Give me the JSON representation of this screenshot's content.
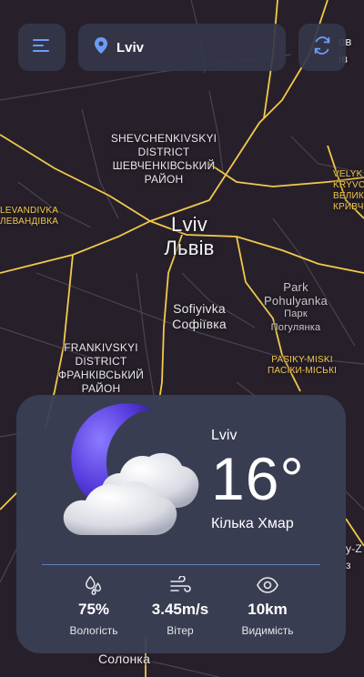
{
  "app": {
    "search": {
      "location": "Lviv"
    },
    "icons": {
      "menu": "menu-lines-icon",
      "location": "location-pin-icon",
      "refresh": "refresh-icon"
    }
  },
  "map": {
    "labels": {
      "shevchenkivskyi": [
        "SHEVCHENKIVSKYI",
        "DISTRICT",
        "ШЕВЧЕНКІВСЬКИЙ",
        "РАЙОН"
      ],
      "lviv_en": "Lviv",
      "lviv_uk": "Львів",
      "sofiyivka": [
        "Sofiyivka",
        "Софіївка"
      ],
      "park": [
        "Park",
        "Pohulyanka",
        "Парк",
        "Погулянка"
      ],
      "frankivskyi": [
        "FRANKIVSKYI",
        "DISTRICT",
        "ФРАНКІВСЬКИЙ",
        "РАЙОН"
      ],
      "levandivka": [
        "LEVANDIVKA",
        "ЛЕВАНДІВКА"
      ],
      "velyki_kryvchytsi": [
        "VELYK",
        "KRYVCHY",
        "ВЕЛИК",
        "КРИВЧ"
      ],
      "pasiky": [
        "PASIKY-MISKI",
        "ПАСІКИ-МІСЬКІ"
      ],
      "solonka": "Солонка",
      "top_right": [
        "ов",
        "ів"
      ],
      "right_edge": [
        "y-Z",
        "з"
      ]
    }
  },
  "weather": {
    "city": "Lviv",
    "temperature": "16°",
    "description": "Кілька Хмар",
    "icon": "moon-cloud-icon",
    "stats": [
      {
        "value": "75%",
        "label": "Вологість",
        "icon": "humidity-drops-icon"
      },
      {
        "value": "3.45m/s",
        "label": "Вітер",
        "icon": "wind-icon"
      },
      {
        "value": "10km",
        "label": "Видимість",
        "icon": "eye-icon"
      }
    ]
  },
  "colors": {
    "map_bg": "#27202b",
    "road_major": "#f2c94c",
    "card_bg": "#3a3f54",
    "button_bg": "#34374a",
    "accent_blue": "#6c9cf5"
  }
}
